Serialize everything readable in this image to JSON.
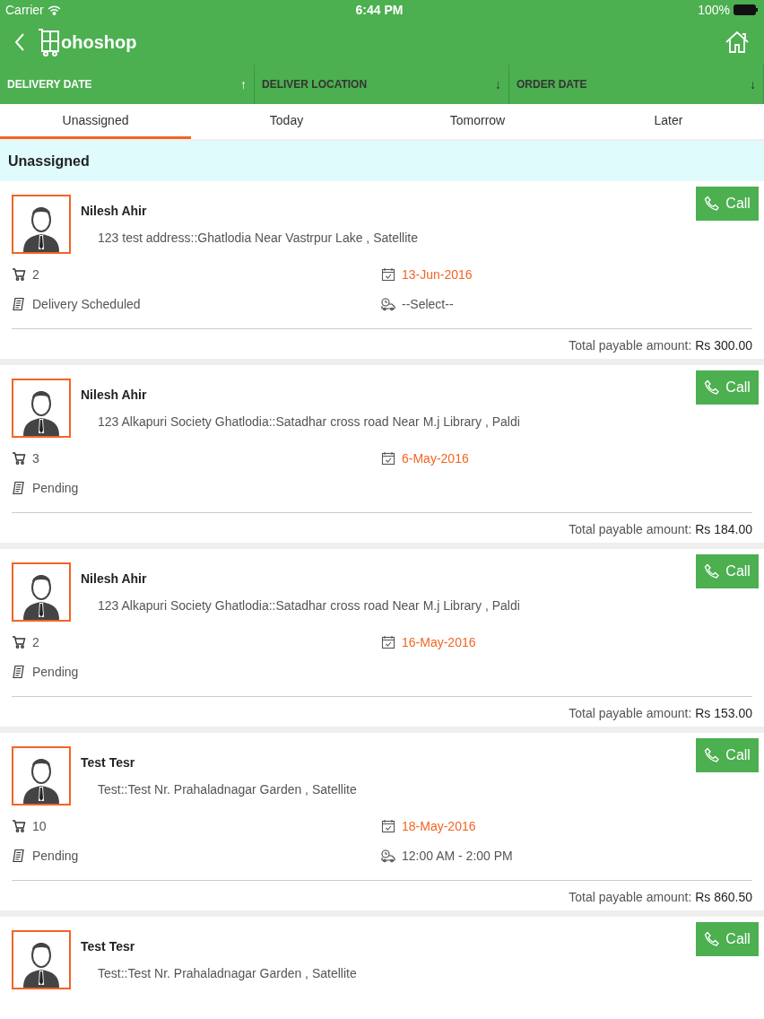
{
  "status_bar": {
    "carrier": "Carrier",
    "time": "6:44 PM",
    "battery": "100%"
  },
  "nav": {
    "logo_text": "ohoshop"
  },
  "sort_columns": [
    {
      "label": "DELIVERY DATE",
      "selected": true,
      "arrow": "↑"
    },
    {
      "label": "DELIVER LOCATION",
      "selected": false,
      "arrow": "↓"
    },
    {
      "label": "ORDER DATE",
      "selected": false,
      "arrow": "↓"
    }
  ],
  "tabs": [
    {
      "label": "Unassigned",
      "selected": true
    },
    {
      "label": "Today",
      "selected": false
    },
    {
      "label": "Tomorrow",
      "selected": false
    },
    {
      "label": "Later",
      "selected": false
    }
  ],
  "section_title": "Unassigned",
  "orders": [
    {
      "name": "Nilesh Ahir",
      "address": "123 test address::Ghatlodia Near Vastrpur Lake , Satellite",
      "call": "Call",
      "items": "2",
      "date": "13-Jun-2016",
      "status": "Delivery Scheduled",
      "slot": "--Select--",
      "total": "Total payable amount: **Rs 300.00**"
    },
    {
      "name": "Nilesh Ahir",
      "address": "123 Alkapuri Society Ghatlodia::Satadhar cross road Near M.j Library , Paldi",
      "call": "Call",
      "items": "3",
      "date": "6-May-2016",
      "status": "Pending",
      "total": "Total payable amount: **Rs 184.00**"
    },
    {
      "name": "Nilesh Ahir",
      "address": "123 Alkapuri Society Ghatlodia::Satadhar cross road Near M.j Library , Paldi",
      "call": "Call",
      "items": "2",
      "date": "16-May-2016",
      "status": "Pending",
      "total": "Total payable amount: **Rs 153.00**"
    },
    {
      "name": "Test Tesr",
      "address": "Test::Test Nr. Prahaladnagar Garden , Satellite",
      "call": "Call",
      "items": "10",
      "date": "18-May-2016",
      "status": "Pending",
      "slot": "12:00 AM - 2:00 PM",
      "total": "Total payable amount: **Rs 860.50**"
    },
    {
      "name": "Test Tesr",
      "address": "Test::Test Nr. Prahaladnagar Garden , Satellite",
      "call": "Call"
    }
  ]
}
